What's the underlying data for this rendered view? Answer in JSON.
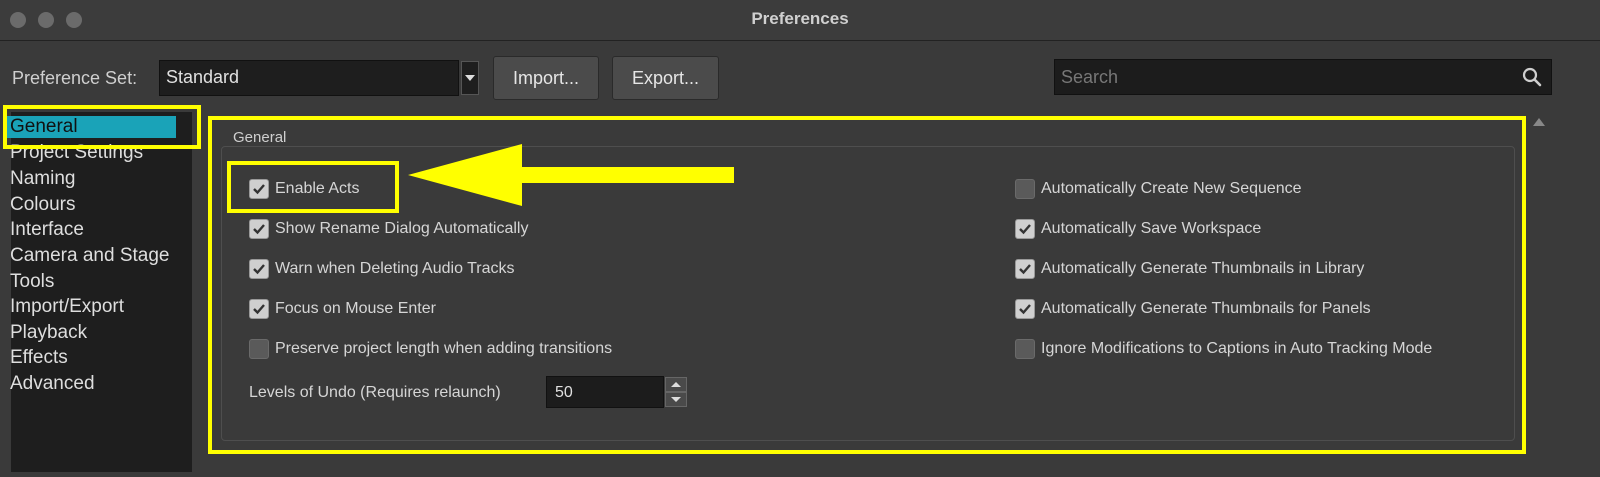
{
  "window": {
    "title": "Preferences",
    "traffic_lights": [
      "close-light",
      "minimize-light",
      "zoom-light"
    ]
  },
  "toolbar": {
    "preference_set_label": "Preference Set:",
    "preference_set_value": "Standard",
    "import_label": "Import...",
    "export_label": "Export...",
    "search_placeholder": "Search",
    "search_icon": "magnifier"
  },
  "sidebar": {
    "items": [
      {
        "label": "General",
        "selected": true
      },
      {
        "label": "Project Settings"
      },
      {
        "label": "Naming"
      },
      {
        "label": "Colours"
      },
      {
        "label": "Interface"
      },
      {
        "label": "Camera and Stage"
      },
      {
        "label": "Tools"
      },
      {
        "label": "Import/Export"
      },
      {
        "label": "Playback"
      },
      {
        "label": "Effects"
      },
      {
        "label": "Advanced"
      }
    ]
  },
  "general": {
    "group_title": "General",
    "left_options": [
      {
        "label": "Enable Acts",
        "checked": true
      },
      {
        "label": "Show Rename Dialog Automatically",
        "checked": true
      },
      {
        "label": "Warn when Deleting Audio Tracks",
        "checked": true
      },
      {
        "label": "Focus on Mouse Enter",
        "checked": true
      },
      {
        "label": "Preserve project length when adding transitions",
        "checked": false
      }
    ],
    "right_options": [
      {
        "label": "Automatically Create New Sequence",
        "checked": false
      },
      {
        "label": "Automatically Save Workspace",
        "checked": true
      },
      {
        "label": "Automatically Generate Thumbnails in Library",
        "checked": true
      },
      {
        "label": "Automatically Generate Thumbnails for Panels",
        "checked": true
      },
      {
        "label": "Ignore Modifications to Captions in Auto Tracking Mode",
        "checked": false
      }
    ],
    "undo_label": "Levels of Undo (Requires relaunch)",
    "undo_value": "50"
  },
  "colors": {
    "highlight": "#ffff00",
    "selection": "#1aa3b8"
  }
}
